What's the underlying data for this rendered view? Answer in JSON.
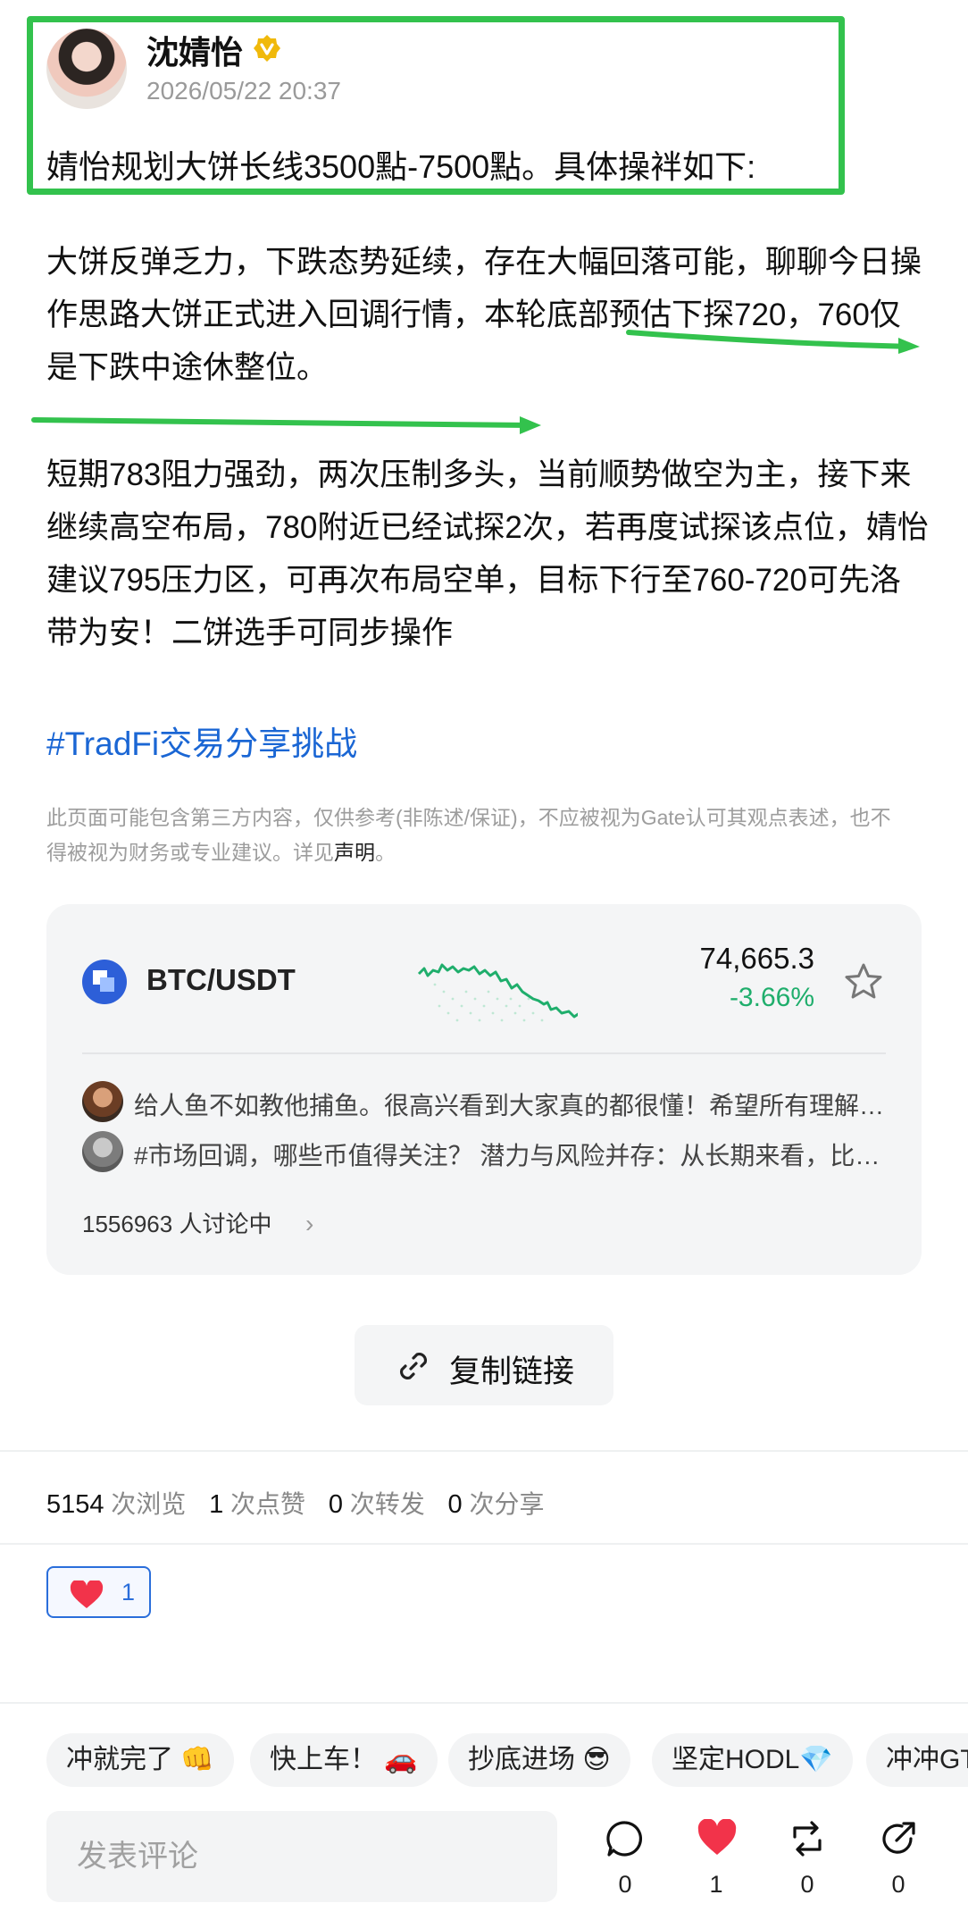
{
  "post": {
    "author": "沈婧怡",
    "timestamp": "2026/05/22 20:37",
    "headline": "婧怡规划大饼长线3500點-7500點。具体操袢如下:",
    "paragraph1": "大饼反弹乏力，下跌态势延续，存在大幅回落可能，聊聊今日操作思路大饼正式进入回调行情，本轮底部预估下探720，760仅是下跌中途休整位。",
    "paragraph2": "短期783阻力强劲，两次压制多头，当前顺势做空为主，接下来继续高空布局，780附近已经试探2次，若再度试探该点位，婧怡建议795压力区，可再次布局空单，目标下行至760-720可先洛带为安！二饼选手可同步操作",
    "hashtag": "#TradFi交易分享挑战",
    "disclaimer": "此页面可能包含第三方内容，仅供参考(非陈述/保证)，不应被视为Gate认可其观点表述，也不得被视为财务或专业建议。详见",
    "disclaimer_link": "声明",
    "disclaimer_end": "。",
    "colors": {
      "highlight_box": "#33c24d",
      "hashtag": "#1a66d4",
      "accent": "#2a6edb"
    }
  },
  "market_card": {
    "pair": "BTC/USDT",
    "price": "74,665.3",
    "change": "-3.66%",
    "change_color": "#1fae6c",
    "comments": [
      {
        "text": "给人鱼不如教他捕鱼。很高兴看到大家真的都很懂！希望所有理解…"
      },
      {
        "text": "#市场回调，哪些币值得关注？ 潜力与风险并存：从长期来看，比…"
      }
    ],
    "discussion_count": "1556963 人讨论中"
  },
  "copy_link_label": "复制链接",
  "stats": {
    "views": "5154",
    "views_label": "次浏览",
    "likes": "1",
    "likes_label": "次点赞",
    "reposts": "0",
    "reposts_label": "次转发",
    "shares": "0",
    "shares_label": "次分享"
  },
  "like_chip_count": "1",
  "reactions": [
    "冲就完了 👊",
    "快上车！ 🚗",
    "抄底进场 😎",
    "坚定HODL💎",
    "冲冲GT"
  ],
  "bottom_bar": {
    "comment_placeholder": "发表评论",
    "comment_count": "0",
    "like_count": "1",
    "repost_count": "0",
    "share_count": "0"
  }
}
